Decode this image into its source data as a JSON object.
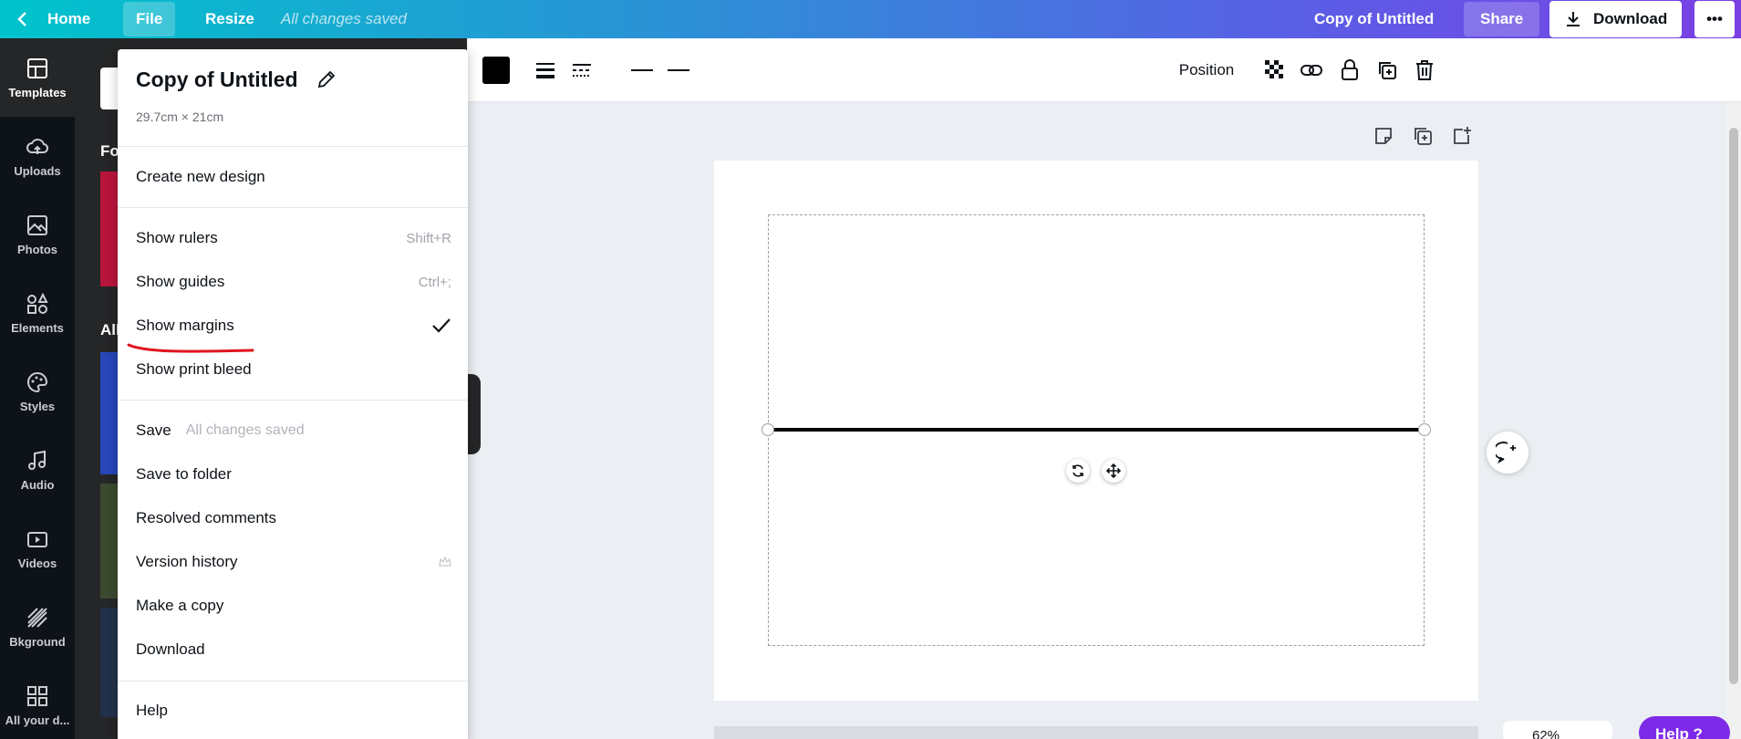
{
  "topbar": {
    "home": "Home",
    "file": "File",
    "resize": "Resize",
    "saved_status": "All changes saved",
    "doc_title": "Copy of Untitled",
    "share": "Share",
    "download": "Download",
    "more": "•••"
  },
  "rail": {
    "items": [
      {
        "label": "Templates",
        "icon": "templates-icon"
      },
      {
        "label": "Uploads",
        "icon": "upload-cloud-icon"
      },
      {
        "label": "Photos",
        "icon": "image-icon"
      },
      {
        "label": "Elements",
        "icon": "shapes-icon"
      },
      {
        "label": "Styles",
        "icon": "palette-icon"
      },
      {
        "label": "Audio",
        "icon": "music-note-icon"
      },
      {
        "label": "Videos",
        "icon": "video-icon"
      },
      {
        "label": "Bkground",
        "icon": "background-icon"
      },
      {
        "label": "All your d...",
        "icon": "grid-icon"
      }
    ]
  },
  "sidepanel": {
    "heading_partial_1": "Fo",
    "heading_partial_2": "All"
  },
  "file_menu": {
    "title": "Copy of Untitled",
    "dimensions": "29.7cm × 21cm",
    "items": {
      "create": "Create new design",
      "rulers": "Show rulers",
      "rulers_shortcut": "Shift+R",
      "guides": "Show guides",
      "guides_shortcut": "Ctrl+;",
      "margins": "Show margins",
      "margins_checked": true,
      "bleed": "Show print bleed",
      "save": "Save",
      "save_hint": "All changes saved",
      "folder": "Save to folder",
      "resolved": "Resolved comments",
      "version": "Version history",
      "copy": "Make a copy",
      "download": "Download",
      "help": "Help"
    }
  },
  "toolbar": {
    "color": "#000000",
    "position": "Position"
  },
  "canvas": {
    "zoom": "62%",
    "help": "Help ?"
  },
  "colors": {
    "annotation": "#e0141e",
    "help_button": "#7d2ae8"
  }
}
